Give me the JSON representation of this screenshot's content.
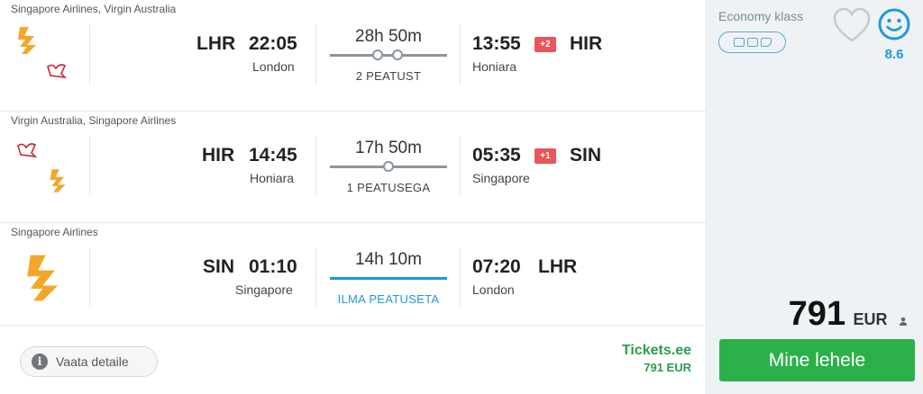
{
  "segments": [
    {
      "carriers": "Singapore Airlines, Virgin Australia",
      "logos": [
        "singapore-airlines-logo",
        "virgin-australia-logo"
      ],
      "dep_code": "LHR",
      "dep_time": "22:05",
      "dep_city": "London",
      "duration": "28h 50m",
      "stops_label": "2 PEATUST",
      "stops": 2,
      "arr_time": "13:55",
      "day_offset": "+2",
      "arr_code": "HIR",
      "arr_city": "Honiara"
    },
    {
      "carriers": "Virgin Australia, Singapore Airlines",
      "logos": [
        "virgin-australia-logo",
        "singapore-airlines-logo"
      ],
      "dep_code": "HIR",
      "dep_time": "14:45",
      "dep_city": "Honiara",
      "duration": "17h 50m",
      "stops_label": "1 PEATUSEGA",
      "stops": 1,
      "arr_time": "05:35",
      "day_offset": "+1",
      "arr_code": "SIN",
      "arr_city": "Singapore"
    },
    {
      "carriers": "Singapore Airlines",
      "logos": [
        "singapore-airlines-logo"
      ],
      "dep_code": "SIN",
      "dep_time": "01:10",
      "dep_city": "Singapore",
      "duration": "14h 10m",
      "stops_label": "ILMA PEATUSETA",
      "stops": 0,
      "arr_time": "07:20",
      "day_offset": "",
      "arr_code": "LHR",
      "arr_city": "London"
    }
  ],
  "details_button": {
    "label": "Vaata detaile",
    "icon": "info-icon"
  },
  "provider": {
    "name": "Tickets.ee",
    "price": "791 EUR"
  },
  "sidebar": {
    "cabin": "Economy klass",
    "amenities": [
      "seat-icon",
      "baggage-icon",
      "legroom-icon"
    ],
    "score": "8.6",
    "price": "791",
    "currency": "EUR",
    "cta_label": "Mine lehele"
  },
  "colors": {
    "accent": "#1e9ad6",
    "cta": "#2cb04a",
    "provider": "#2a9d4b",
    "day_badge": "#e8555b"
  }
}
